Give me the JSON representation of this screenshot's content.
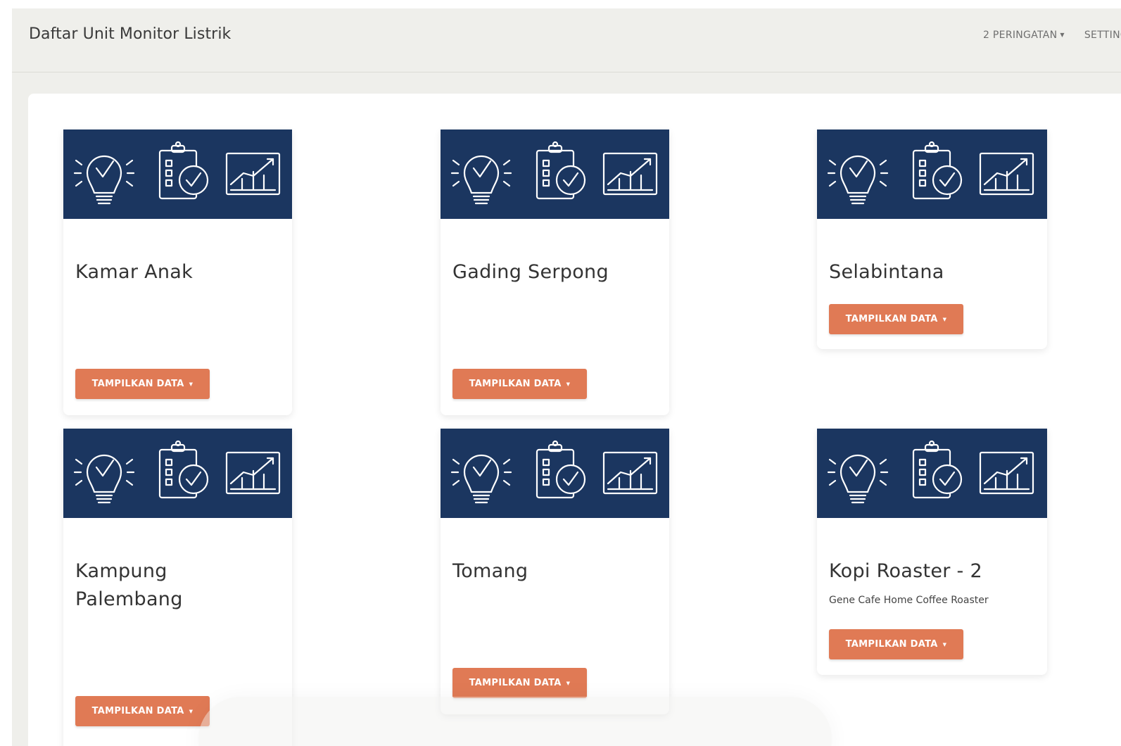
{
  "navbar": {
    "brand": "Daftar Unit Monitor Listrik",
    "warnings_label": "2 PERINGATAN",
    "settings_label": "SETTING"
  },
  "colors": {
    "page_bg": "#efefeb",
    "card_image_bg": "#1b3660",
    "button_bg": "#e07a55",
    "button_text": "#ffffff"
  },
  "card_image_icons": [
    "lightbulb-check-icon",
    "clipboard-check-icon",
    "line-chart-icon"
  ],
  "cards": [
    {
      "title": "Kamar Anak",
      "subtitle": "",
      "button": "TAMPILKAN DATA"
    },
    {
      "title": "Gading Serpong",
      "subtitle": "",
      "button": "TAMPILKAN DATA"
    },
    {
      "title": "Selabintana",
      "subtitle": "",
      "button": "TAMPILKAN DATA"
    },
    {
      "title": "Kampung Palembang",
      "subtitle": "",
      "button": "TAMPILKAN DATA"
    },
    {
      "title": "Tomang",
      "subtitle": "",
      "button": "TAMPILKAN DATA"
    },
    {
      "title": "Kopi Roaster - 2",
      "subtitle": "Gene Cafe Home Coffee Roaster",
      "button": "TAMPILKAN DATA"
    }
  ]
}
